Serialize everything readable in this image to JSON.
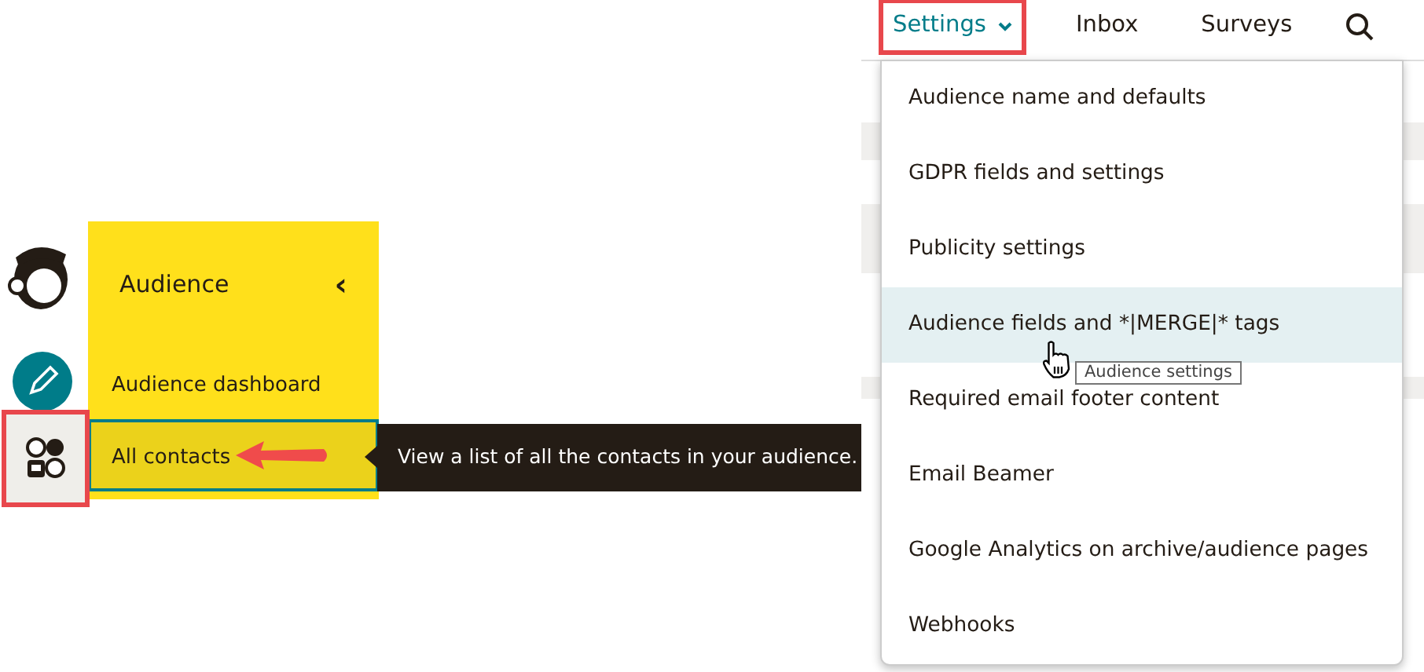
{
  "rail": {
    "items": [
      {
        "kind": "logo",
        "selected": false
      },
      {
        "kind": "create",
        "selected": false
      },
      {
        "kind": "audience",
        "selected": true
      }
    ]
  },
  "audience_menu": {
    "title": "Audience",
    "collapse_icon": "‹",
    "items": [
      {
        "label": "Audience dashboard",
        "selected": false
      },
      {
        "label": "All contacts",
        "selected": true
      }
    ]
  },
  "callout": {
    "text": "View a list of all the contacts in your audience."
  },
  "top_nav": {
    "items": [
      {
        "label": "Settings",
        "selected": true,
        "has_menu": true
      },
      {
        "label": "Inbox",
        "selected": false,
        "has_menu": false
      },
      {
        "label": "Surveys",
        "selected": false,
        "has_menu": false
      }
    ]
  },
  "settings_menu": {
    "items": [
      {
        "label": "Audience name and defaults",
        "hovered": false
      },
      {
        "label": "GDPR fields and settings",
        "hovered": false
      },
      {
        "label": "Publicity settings",
        "hovered": false
      },
      {
        "label": "Audience fields and *|MERGE|* tags",
        "hovered": true
      },
      {
        "label": "Required email footer content",
        "hovered": false
      },
      {
        "label": "Email Beamer",
        "hovered": false
      },
      {
        "label": "Google Analytics on archive/audience pages",
        "hovered": false
      },
      {
        "label": "Webhooks",
        "hovered": false
      }
    ]
  },
  "hover_tooltip": {
    "text": "Audience settings"
  }
}
